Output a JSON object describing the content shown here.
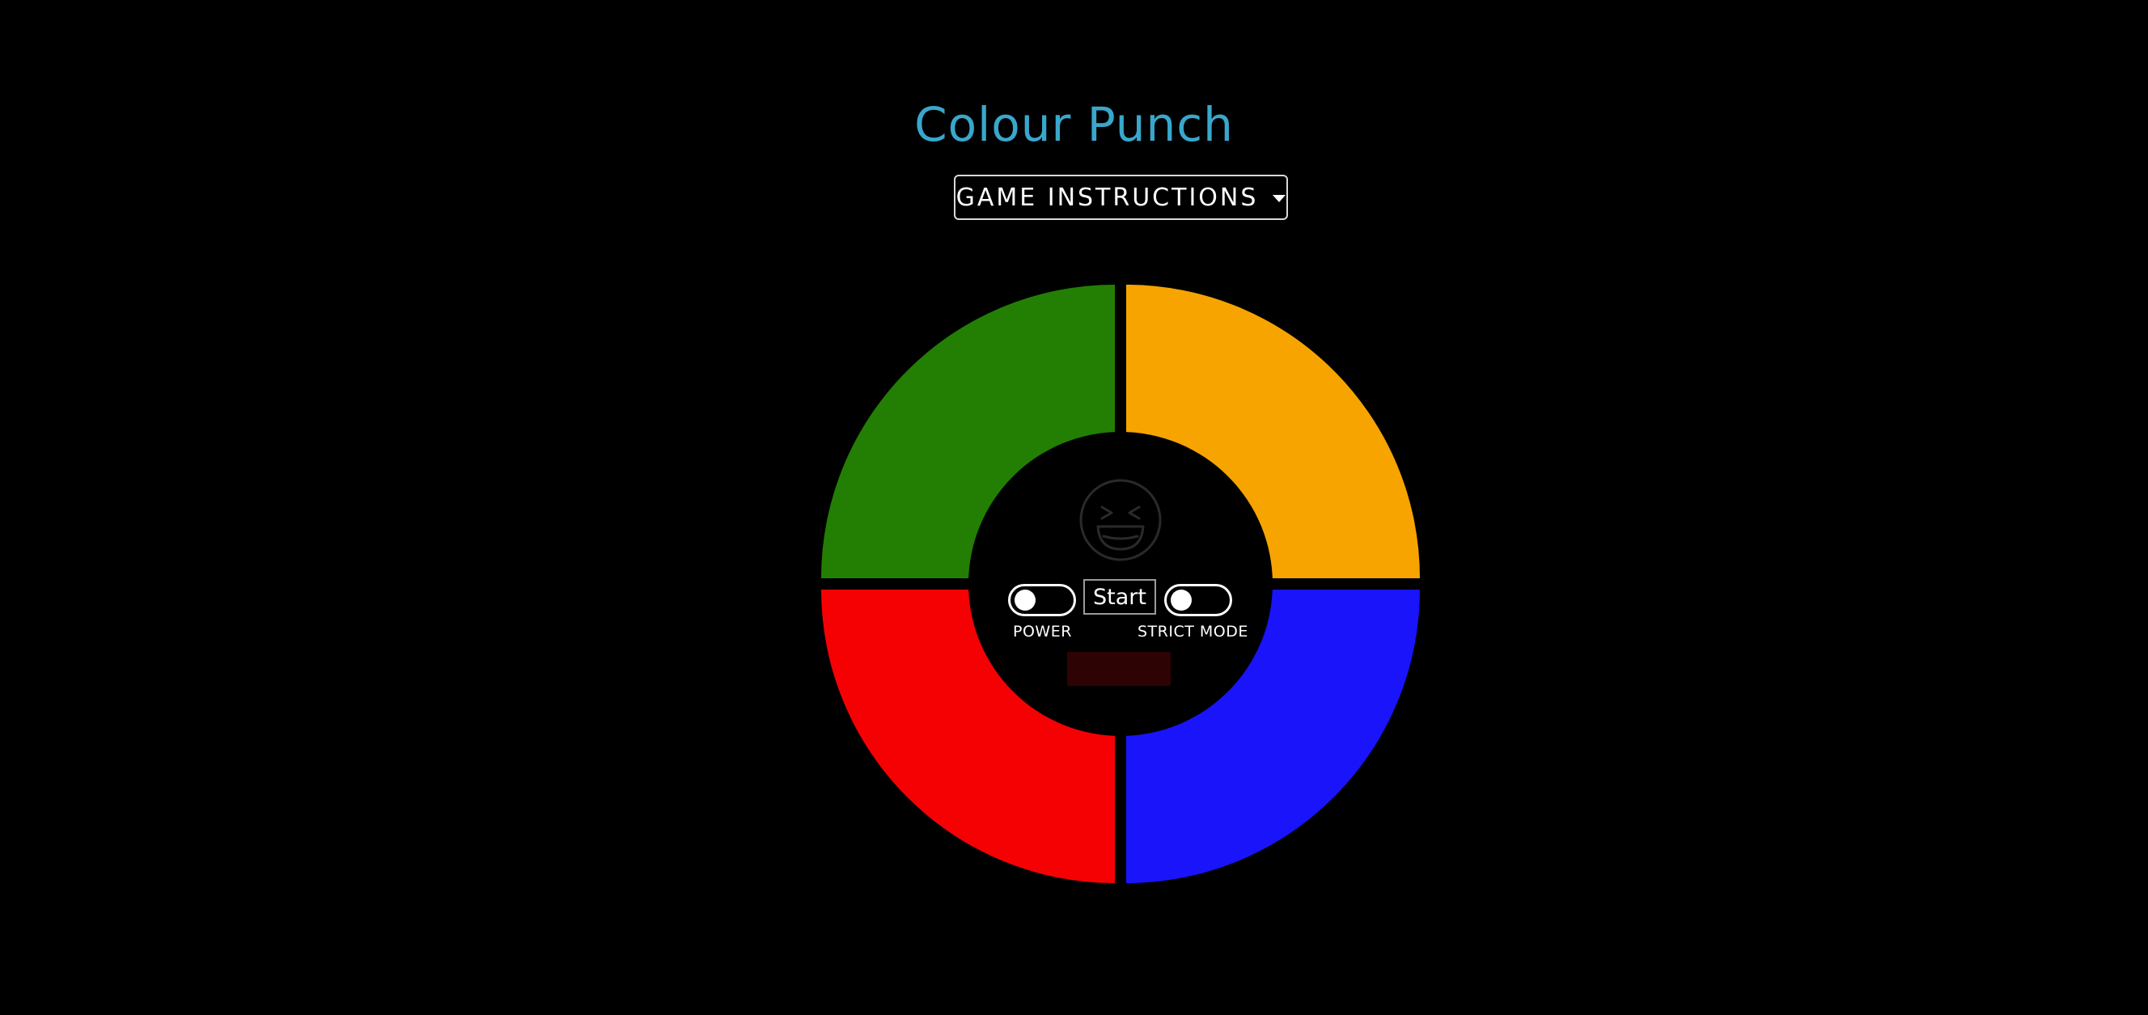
{
  "title": "Colour Punch",
  "instructions_label": "GAME INSTRUCTIONS",
  "controls": {
    "start_label": "Start",
    "power_label": "POWER",
    "strict_label": "STRICT MODE",
    "power_on": false,
    "strict_on": false,
    "counter_text": ""
  },
  "colors": {
    "title": "#39a7cc",
    "green": "#237f03",
    "yellow": "#f7a401",
    "red": "#f50103",
    "blue": "#1a14fb",
    "counter_bg": "#2e0303",
    "emoji": "#2a2a2a"
  },
  "icons": {
    "emoji": "laughing-face-icon",
    "dropdown": "caret-down-icon"
  }
}
